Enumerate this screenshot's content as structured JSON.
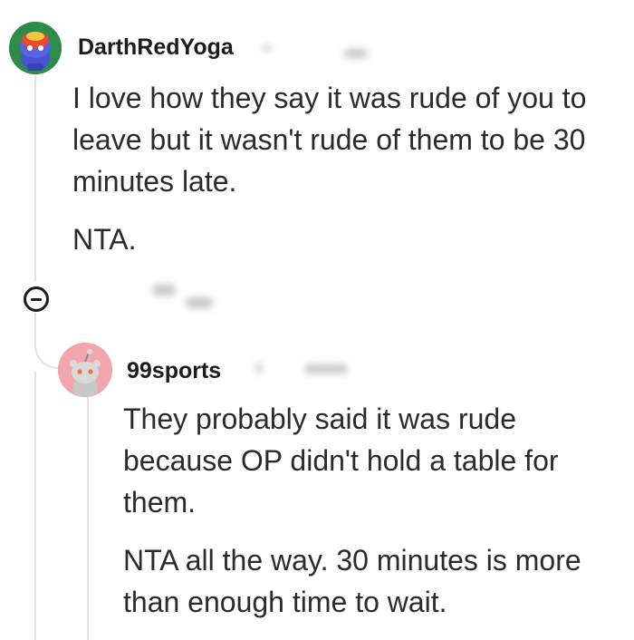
{
  "comments": [
    {
      "username": "DarthRedYoga",
      "avatar": "snoo-avatar-helmet",
      "paragraphs": [
        "I love how they say it was rude of you to leave but it wasn't rude of them to be 30 minutes late.",
        "NTA."
      ]
    },
    {
      "username": "99sports",
      "avatar": "snoo-avatar-default",
      "paragraphs": [
        "They probably said it was rude because OP didn't hold a table for them.",
        "NTA all the way. 30 minutes is more than enough time to wait."
      ]
    }
  ],
  "icons": {
    "collapse": "collapse-thread-icon"
  },
  "colors": {
    "thread_line": "#e2e2e2",
    "avatar_bg_1": "#1f7a3a",
    "avatar_bg_2": "#f1a6ae"
  }
}
